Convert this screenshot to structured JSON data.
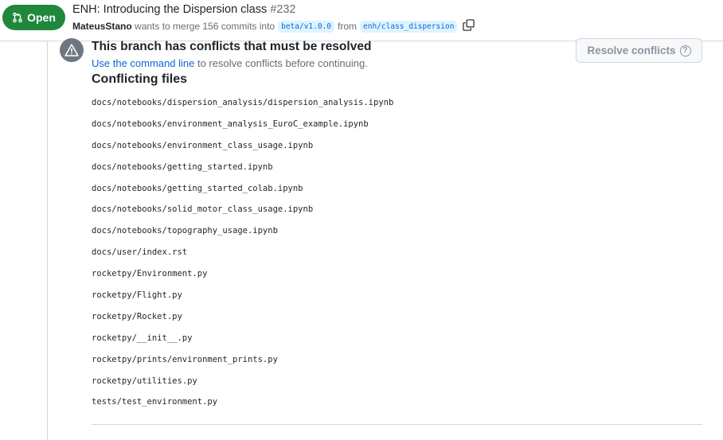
{
  "header": {
    "state": "Open",
    "title": "ENH: Introducing the Dispersion class",
    "number": "#232",
    "author": "MateusStano",
    "merge_text": "wants to merge 156 commits into",
    "base_branch": "beta/v1.0.0",
    "from_text": "from",
    "head_branch": "enh/class_dispersion",
    "icons": {
      "state": "git-pull-request-icon",
      "copy": "copy-icon"
    }
  },
  "conflicts": {
    "title": "This branch has conflicts that must be resolved",
    "link_text": "Use the command line",
    "rest_text": " to resolve conflicts before continuing.",
    "resolve_button": "Resolve conflicts",
    "help_glyph": "?",
    "files_heading": "Conflicting files",
    "icons": {
      "alert": "alert-icon",
      "help": "question-icon"
    },
    "files": [
      "docs/notebooks/dispersion_analysis/dispersion_analysis.ipynb",
      "docs/notebooks/environment_analysis_EuroC_example.ipynb",
      "docs/notebooks/environment_class_usage.ipynb",
      "docs/notebooks/getting_started.ipynb",
      "docs/notebooks/getting_started_colab.ipynb",
      "docs/notebooks/solid_motor_class_usage.ipynb",
      "docs/notebooks/topography_usage.ipynb",
      "docs/user/index.rst",
      "rocketpy/Environment.py",
      "rocketpy/Flight.py",
      "rocketpy/Rocket.py",
      "rocketpy/__init__.py",
      "rocketpy/prints/environment_prints.py",
      "rocketpy/utilities.py",
      "tests/test_environment.py"
    ]
  },
  "colors": {
    "open_green": "#1f883d",
    "link_blue": "#0969da",
    "branch_bg": "#ddf4ff",
    "muted": "#656d76",
    "border": "#d0d7de"
  }
}
